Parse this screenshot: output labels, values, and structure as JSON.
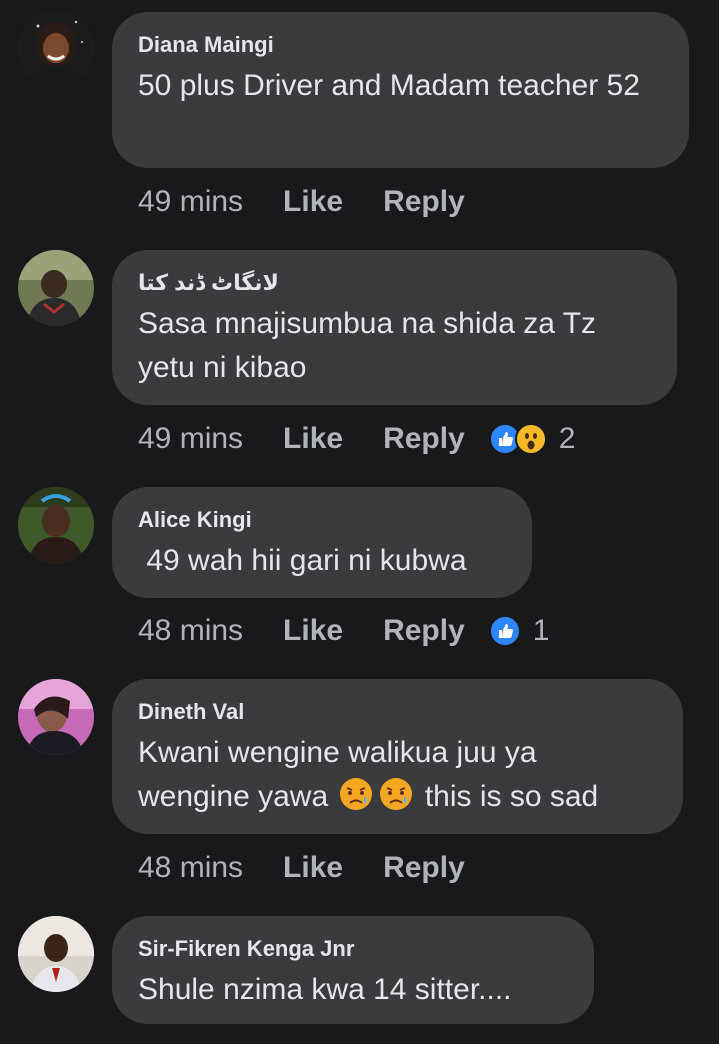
{
  "comments": [
    {
      "author": "Diana Maingi",
      "text": "50 plus Driver  and Madam teacher 52",
      "time": "49 mins",
      "like": "Like",
      "reply": "Reply",
      "reactions": null
    },
    {
      "author": "لانگاٹ ڈند کتا",
      "text": "Sasa mnajisumbua na shida za Tz yetu ni kibao",
      "time": "49 mins",
      "like": "Like",
      "reply": "Reply",
      "reactions": {
        "icons": [
          "like-icon",
          "wow-icon"
        ],
        "count": "2"
      }
    },
    {
      "author": "Alice Kingi",
      "text": " 49 wah hii gari ni kubwa",
      "time": "48 mins",
      "like": "Like",
      "reply": "Reply",
      "reactions": {
        "icons": [
          "like-icon"
        ],
        "count": "1"
      }
    },
    {
      "author": "Dineth Val",
      "text_line1": "Kwani wengine walikua juu ya",
      "text_line2_a": "wengine yawa",
      "text_line2_emoji": [
        "sad-tear-face-icon",
        "sad-tear-face-icon"
      ],
      "text_line2_b": "this is so sad",
      "time": "48 mins",
      "like": "Like",
      "reply": "Reply",
      "reactions": null
    },
    {
      "author": "Sir-Fikren Kenga Jnr",
      "text": "Shule nzima kwa 14 sitter....",
      "reactions": null
    }
  ],
  "colors": {
    "background": "#18191a",
    "bubble": "#3a3b3c",
    "primary_text": "#e4e6eb",
    "secondary_text": "#b0b3b8",
    "like_blue": "#2d88ff",
    "wow_yellow": "#f7b928"
  }
}
